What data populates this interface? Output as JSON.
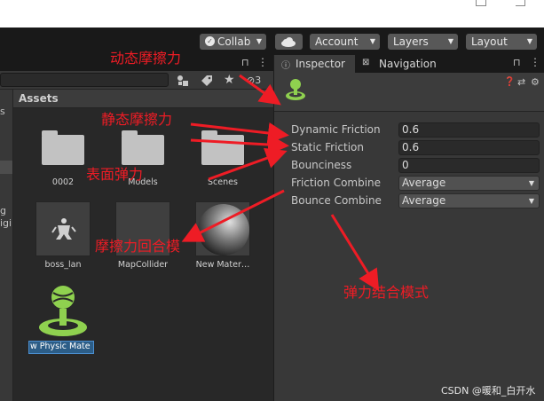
{
  "toolbar": {
    "collab": "Collab",
    "account": "Account",
    "layers": "Layers",
    "layout": "Layout"
  },
  "project": {
    "hidden_count": "3",
    "assets_header": "Assets",
    "left_edge_text": [
      "s",
      "g",
      "igi"
    ],
    "assets": [
      {
        "name": "0002",
        "kind": "folder"
      },
      {
        "name": "Models",
        "kind": "folder"
      },
      {
        "name": "Scenes",
        "kind": "folder"
      },
      {
        "name": "boss_lan",
        "kind": "model"
      },
      {
        "name": "MapCollider",
        "kind": "prefab"
      },
      {
        "name": "New Mater…",
        "kind": "material"
      },
      {
        "name": "w Physic Mate",
        "kind": "physic-material",
        "selected": true
      }
    ]
  },
  "inspector": {
    "tabs": [
      "Inspector",
      "Navigation"
    ],
    "properties": [
      {
        "label": "Dynamic Friction",
        "value": "0.6",
        "type": "field"
      },
      {
        "label": "Static Friction",
        "value": "0.6",
        "type": "field"
      },
      {
        "label": "Bounciness",
        "value": "0",
        "type": "field"
      },
      {
        "label": "Friction Combine",
        "value": "Average",
        "type": "dropdown"
      },
      {
        "label": "Bounce Combine",
        "value": "Average",
        "type": "dropdown"
      }
    ]
  },
  "annotations": [
    "动态摩擦力",
    "静态摩擦力",
    "表面弹力",
    "摩擦力回合模",
    "弹力结合模式"
  ],
  "watermark": "CSDN @暖和_白开水",
  "colors": {
    "annotation": "#ee1c25",
    "physic_icon": "#8fd14f",
    "selection": "#2c5d87"
  }
}
